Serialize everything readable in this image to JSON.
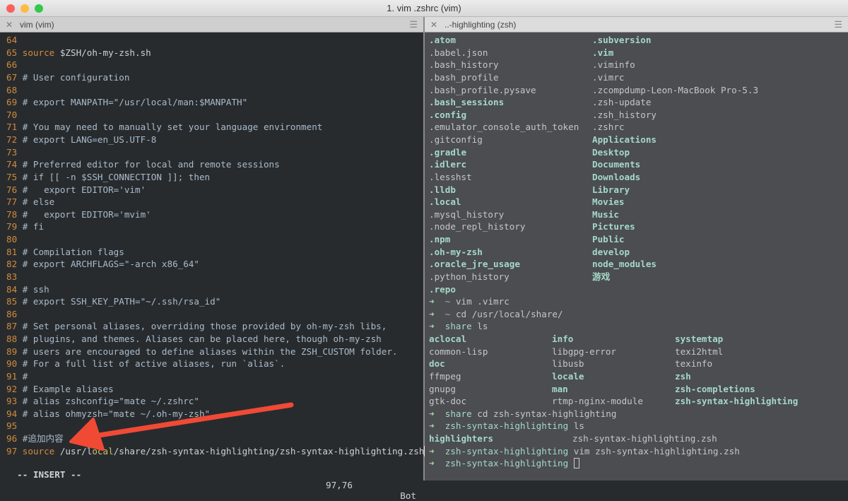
{
  "window": {
    "title": "1. vim .zshrc (vim)"
  },
  "tabs": [
    {
      "label": "vim (vim)"
    },
    {
      "label": "..-highlighting (zsh)"
    }
  ],
  "colors": {
    "accent_arrow": "#f04a35",
    "line_number": "#d08a3c",
    "dir": "#a6d8c8"
  },
  "vim": {
    "lines": [
      {
        "n": "64",
        "segs": []
      },
      {
        "n": "65",
        "segs": [
          {
            "t": "source",
            "c": "kw"
          },
          {
            "t": " $ZSH/oh-my-zsh.sh",
            "c": "pl"
          }
        ]
      },
      {
        "n": "66",
        "segs": []
      },
      {
        "n": "67",
        "segs": [
          {
            "t": "# User configuration",
            "c": ""
          }
        ]
      },
      {
        "n": "68",
        "segs": []
      },
      {
        "n": "69",
        "segs": [
          {
            "t": "# export MANPATH=\"/usr/local/man:$MANPATH\"",
            "c": ""
          }
        ]
      },
      {
        "n": "70",
        "segs": []
      },
      {
        "n": "71",
        "segs": [
          {
            "t": "# You may need to manually set your language environment",
            "c": ""
          }
        ]
      },
      {
        "n": "72",
        "segs": [
          {
            "t": "# export LANG=en_US.UTF-8",
            "c": ""
          }
        ]
      },
      {
        "n": "73",
        "segs": []
      },
      {
        "n": "74",
        "segs": [
          {
            "t": "# Preferred editor for local and remote sessions",
            "c": ""
          }
        ]
      },
      {
        "n": "75",
        "segs": [
          {
            "t": "# if [[ -n $SSH_CONNECTION ]]; then",
            "c": ""
          }
        ]
      },
      {
        "n": "76",
        "segs": [
          {
            "t": "#   export EDITOR='vim'",
            "c": ""
          }
        ]
      },
      {
        "n": "77",
        "segs": [
          {
            "t": "# else",
            "c": ""
          }
        ]
      },
      {
        "n": "78",
        "segs": [
          {
            "t": "#   export EDITOR='mvim'",
            "c": ""
          }
        ]
      },
      {
        "n": "79",
        "segs": [
          {
            "t": "# fi",
            "c": ""
          }
        ]
      },
      {
        "n": "80",
        "segs": []
      },
      {
        "n": "81",
        "segs": [
          {
            "t": "# Compilation flags",
            "c": ""
          }
        ]
      },
      {
        "n": "82",
        "segs": [
          {
            "t": "# export ARCHFLAGS=\"-arch x86_64\"",
            "c": ""
          }
        ]
      },
      {
        "n": "83",
        "segs": []
      },
      {
        "n": "84",
        "segs": [
          {
            "t": "# ssh",
            "c": ""
          }
        ]
      },
      {
        "n": "85",
        "segs": [
          {
            "t": "# export SSH_KEY_PATH=\"~/.ssh/rsa_id\"",
            "c": ""
          }
        ]
      },
      {
        "n": "86",
        "segs": []
      },
      {
        "n": "87",
        "segs": [
          {
            "t": "# Set personal aliases, overriding those provided by oh-my-zsh libs,",
            "c": ""
          }
        ]
      },
      {
        "n": "88",
        "segs": [
          {
            "t": "# plugins, and themes. Aliases can be placed here, though oh-my-zsh",
            "c": ""
          }
        ]
      },
      {
        "n": "89",
        "segs": [
          {
            "t": "# users are encouraged to define aliases within the ZSH_CUSTOM folder.",
            "c": ""
          }
        ]
      },
      {
        "n": "90",
        "segs": [
          {
            "t": "# For a full list of active aliases, run `alias`.",
            "c": ""
          }
        ]
      },
      {
        "n": "91",
        "segs": [
          {
            "t": "#",
            "c": ""
          }
        ]
      },
      {
        "n": "92",
        "segs": [
          {
            "t": "# Example aliases",
            "c": ""
          }
        ]
      },
      {
        "n": "93",
        "segs": [
          {
            "t": "# alias zshconfig=\"mate ~/.zshrc\"",
            "c": ""
          }
        ]
      },
      {
        "n": "94",
        "segs": [
          {
            "t": "# alias ohmyzsh=\"mate ~/.oh-my-zsh\"",
            "c": ""
          }
        ]
      },
      {
        "n": "95",
        "segs": []
      },
      {
        "n": "96",
        "segs": [
          {
            "t": "#追加内容",
            "c": ""
          }
        ]
      },
      {
        "n": "97",
        "segs": [
          {
            "t": "source",
            "c": "kw"
          },
          {
            "t": " /usr/l",
            "c": "pl"
          },
          {
            "t": "ocal",
            "c": "yl"
          },
          {
            "t": "/share/zsh-syntax-highlighting/zsh-syntax-highlighting.zsh",
            "c": "pl"
          }
        ],
        "cursor": true
      }
    ],
    "mode": "-- INSERT --",
    "position": "97,76",
    "scroll": "Bot"
  },
  "home_ls": [
    [
      {
        "t": ".atom",
        "d": 1
      },
      {
        "t": ".subversion",
        "d": 1
      }
    ],
    [
      {
        "t": ".babel.json",
        "d": 0
      },
      {
        "t": ".vim",
        "d": 1
      }
    ],
    [
      {
        "t": ".bash_history",
        "d": 0
      },
      {
        "t": ".viminfo",
        "d": 0
      }
    ],
    [
      {
        "t": ".bash_profile",
        "d": 0
      },
      {
        "t": ".vimrc",
        "d": 0
      }
    ],
    [
      {
        "t": ".bash_profile.pysave",
        "d": 0
      },
      {
        "t": ".zcompdump-Leon-MacBook Pro-5.3",
        "d": 0
      }
    ],
    [
      {
        "t": ".bash_sessions",
        "d": 1
      },
      {
        "t": ".zsh-update",
        "d": 0
      }
    ],
    [
      {
        "t": ".config",
        "d": 1
      },
      {
        "t": ".zsh_history",
        "d": 0
      }
    ],
    [
      {
        "t": ".emulator_console_auth_token",
        "d": 0
      },
      {
        "t": ".zshrc",
        "d": 0
      }
    ],
    [
      {
        "t": ".gitconfig",
        "d": 0
      },
      {
        "t": "Applications",
        "d": 1
      }
    ],
    [
      {
        "t": ".gradle",
        "d": 1
      },
      {
        "t": "Desktop",
        "d": 1
      }
    ],
    [
      {
        "t": ".idlerc",
        "d": 1
      },
      {
        "t": "Documents",
        "d": 1
      }
    ],
    [
      {
        "t": ".lesshst",
        "d": 0
      },
      {
        "t": "Downloads",
        "d": 1
      }
    ],
    [
      {
        "t": ".lldb",
        "d": 1
      },
      {
        "t": "Library",
        "d": 1
      }
    ],
    [
      {
        "t": ".local",
        "d": 1
      },
      {
        "t": "Movies",
        "d": 1
      }
    ],
    [
      {
        "t": ".mysql_history",
        "d": 0
      },
      {
        "t": "Music",
        "d": 1
      }
    ],
    [
      {
        "t": ".node_repl_history",
        "d": 0
      },
      {
        "t": "Pictures",
        "d": 1
      }
    ],
    [
      {
        "t": ".npm",
        "d": 1
      },
      {
        "t": "Public",
        "d": 1
      }
    ],
    [
      {
        "t": ".oh-my-zsh",
        "d": 1
      },
      {
        "t": "develop",
        "d": 1
      }
    ],
    [
      {
        "t": ".oracle_jre_usage",
        "d": 1
      },
      {
        "t": "node_modules",
        "d": 1
      }
    ],
    [
      {
        "t": ".python_history",
        "d": 0
      },
      {
        "t": "游戏",
        "d": 1
      }
    ],
    [
      {
        "t": ".repo",
        "d": 1
      }
    ]
  ],
  "prompts1": [
    {
      "dir": "~",
      "cmd": "vim .vimrc"
    },
    {
      "dir": "~",
      "cmd": "cd /usr/local/share/"
    },
    {
      "dir": "share",
      "cmd": "ls"
    }
  ],
  "share_ls": [
    [
      {
        "t": "aclocal",
        "d": 1
      },
      {
        "t": "info",
        "d": 1
      },
      {
        "t": "systemtap",
        "d": 1
      }
    ],
    [
      {
        "t": "common-lisp",
        "d": 0
      },
      {
        "t": "libgpg-error",
        "d": 0
      },
      {
        "t": "texi2html",
        "d": 0
      }
    ],
    [
      {
        "t": "doc",
        "d": 1
      },
      {
        "t": "libusb",
        "d": 0
      },
      {
        "t": "texinfo",
        "d": 0
      }
    ],
    [
      {
        "t": "ffmpeg",
        "d": 0
      },
      {
        "t": "locale",
        "d": 1
      },
      {
        "t": "zsh",
        "d": 1
      }
    ],
    [
      {
        "t": "gnupg",
        "d": 0
      },
      {
        "t": "man",
        "d": 1
      },
      {
        "t": "zsh-completions",
        "d": 1
      }
    ],
    [
      {
        "t": "gtk-doc",
        "d": 0
      },
      {
        "t": "rtmp-nginx-module",
        "d": 0
      },
      {
        "t": "zsh-syntax-highlighting",
        "d": 1
      }
    ]
  ],
  "prompts2": [
    {
      "dir": "share",
      "cmd": "cd zsh-syntax-highlighting"
    },
    {
      "dir": "zsh-syntax-highlighting",
      "cmd": "ls"
    }
  ],
  "hl_ls": [
    {
      "t": "highlighters",
      "d": 1
    },
    {
      "t": "zsh-syntax-highlighting.zsh",
      "d": 0
    }
  ],
  "prompts3": [
    {
      "dir": "zsh-syntax-highlighting",
      "cmd": "vim zsh-syntax-highlighting.zsh"
    },
    {
      "dir": "zsh-syntax-highlighting",
      "cmd": ""
    }
  ],
  "icons": {
    "prompt_arrow": "➜",
    "close": "✕",
    "menu": "☰"
  }
}
